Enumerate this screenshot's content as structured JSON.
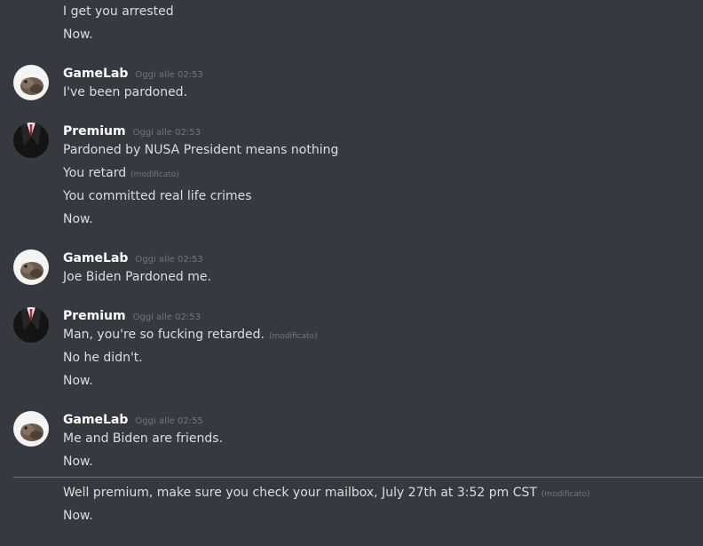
{
  "colors": {
    "background": "#36393f",
    "text": "#dcddde",
    "muted": "#72767d",
    "new_messages_divider": "#d84a4a"
  },
  "messages": [
    {
      "lines": [
        {
          "text": "I get you arrested"
        },
        {
          "text": "Now."
        }
      ]
    },
    {
      "author": "GameLab",
      "avatar": "gamelab-avatar",
      "timestamp": "Oggi alle 02:53",
      "lines": [
        {
          "text": "I've been pardoned."
        }
      ]
    },
    {
      "author": "Premium",
      "avatar": "premium-avatar-suit",
      "timestamp": "Oggi alle 02:53",
      "lines": [
        {
          "text": "Pardoned by NUSA President means nothing"
        },
        {
          "text": "You retard",
          "edited": "(modificato)"
        },
        {
          "text": "You committed real life crimes"
        },
        {
          "text": "Now."
        }
      ]
    },
    {
      "author": "GameLab",
      "avatar": "gamelab-avatar",
      "timestamp": "Oggi alle 02:53",
      "lines": [
        {
          "text": "Joe Biden Pardoned me."
        }
      ]
    },
    {
      "author": "Premium",
      "avatar": "premium-avatar-suit",
      "timestamp": "Oggi alle 02:53",
      "lines": [
        {
          "text": "Man, you're so fucking retarded.",
          "edited": "(modificato)"
        },
        {
          "text": "No he didn't."
        },
        {
          "text": "Now."
        }
      ]
    },
    {
      "author": "GameLab",
      "avatar": "gamelab-avatar",
      "timestamp": "Oggi alle 02:55",
      "lines": [
        {
          "text": "Me and Biden are friends."
        },
        {
          "text": "Now."
        },
        {
          "text": "Well premium, make sure you check your mailbox, July 27th at 3:52 pm CST",
          "edited": "(modificato)"
        },
        {
          "text": "Now."
        }
      ]
    }
  ]
}
